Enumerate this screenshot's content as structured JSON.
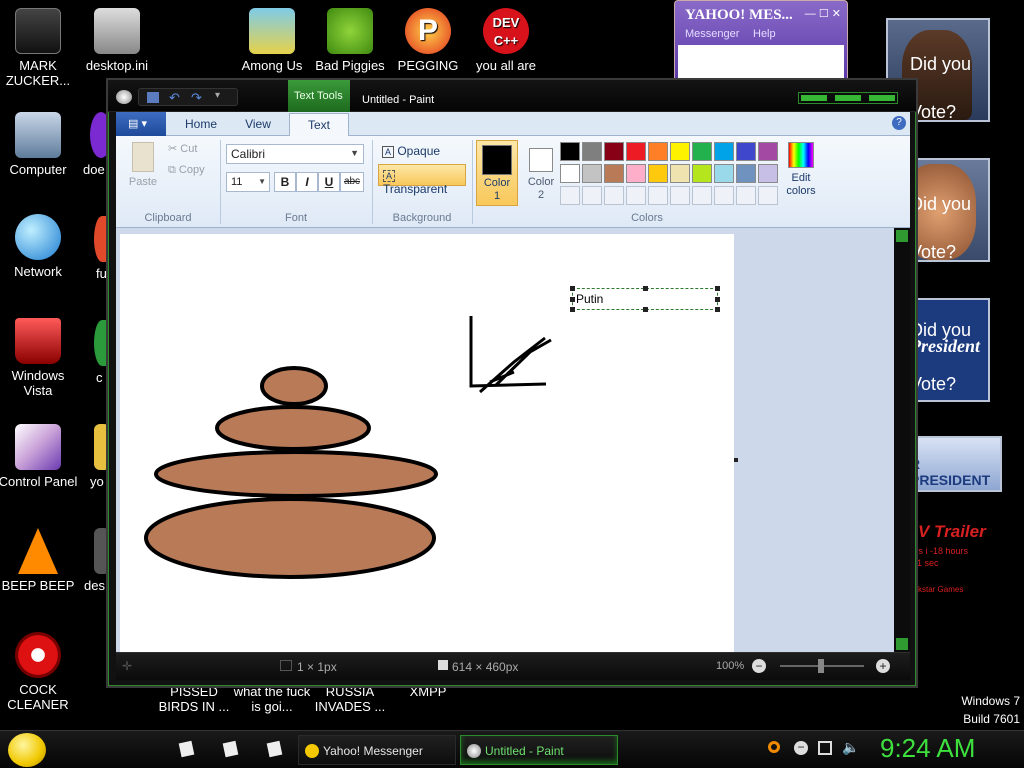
{
  "desktop": {
    "left_icons": [
      {
        "label": "MARK ZUCKER..."
      },
      {
        "label": "Computer"
      },
      {
        "label": "Network"
      },
      {
        "label": "Windows Vista"
      },
      {
        "label": "Control Panel"
      },
      {
        "label": "BEEP BEEP"
      },
      {
        "label": "COCK CLEANER"
      }
    ],
    "second_column": [
      {
        "label": "desktop.ini"
      },
      {
        "label": "doe"
      },
      {
        "label": "fu"
      },
      {
        "label": "c"
      },
      {
        "label": "yo"
      },
      {
        "label": "des"
      }
    ],
    "top_icons": [
      {
        "label": "Among Us"
      },
      {
        "label": "Bad Piggies"
      },
      {
        "label": "PEGGING"
      },
      {
        "label": "you all are"
      }
    ],
    "bottom_icons": [
      {
        "label": "PISSED BIRDS IN ..."
      },
      {
        "label": "what the fuck is goi..."
      },
      {
        "label": "RUSSIA INVADES ..."
      },
      {
        "label": "XMPP"
      }
    ],
    "dev_icon_text": "DEV C++",
    "windows_version": "Windows 7",
    "build": "Build 7601"
  },
  "yahoo": {
    "title": "YAHOO! MES...",
    "menu_messenger": "Messenger",
    "menu_help": "Help"
  },
  "ads": {
    "ad1": "Did you Vote?",
    "ad2": "Did you Vote?",
    "ad3_line1": "Did you",
    "ad3_line2": "President",
    "ad3_line3": "Vote?",
    "ad4": "R PRESIDENT",
    "ad5_title": "V Trailer",
    "ad5_line1": "vs i -18 hours",
    "ad5_line2": "-1 sec",
    "ad5_line3": "ckstar Games"
  },
  "paint": {
    "context_tab": "Text Tools",
    "window_title": "Untitled - Paint",
    "tabs": [
      "Home",
      "View",
      "Text"
    ],
    "clipboard": {
      "paste": "Paste",
      "cut": "Cut",
      "copy": "Copy",
      "group": "Clipboard"
    },
    "font": {
      "family": "Calibri",
      "size": "11",
      "group": "Font",
      "bold": "B",
      "italic": "I",
      "underline": "U",
      "strike": "abc"
    },
    "background": {
      "opaque": "Opaque",
      "transparent": "Transparent",
      "group": "Background"
    },
    "colors": {
      "color1": "Color 1",
      "color2": "Color 2",
      "edit": "Edit colors",
      "group": "Colors",
      "row1": [
        "#000000",
        "#7f7f7f",
        "#880015",
        "#ed1c24",
        "#ff7f27",
        "#fff200",
        "#22b14c",
        "#00a2e8",
        "#3f48cc",
        "#a349a4"
      ],
      "row2": [
        "#ffffff",
        "#c3c3c3",
        "#b97a57",
        "#ffaec9",
        "#ffc90e",
        "#efe4b0",
        "#b5e61d",
        "#99d9ea",
        "#7092be",
        "#c8bfe7"
      ]
    },
    "textbox": "Putin",
    "status": {
      "selection": "1 × 1px",
      "canvas_size": "614 × 460px",
      "zoom": "100%"
    }
  },
  "taskbar": {
    "yahoo_task": "Yahoo! Messenger",
    "paint_task": "Untitled - Paint",
    "clock": "9:24 AM"
  }
}
